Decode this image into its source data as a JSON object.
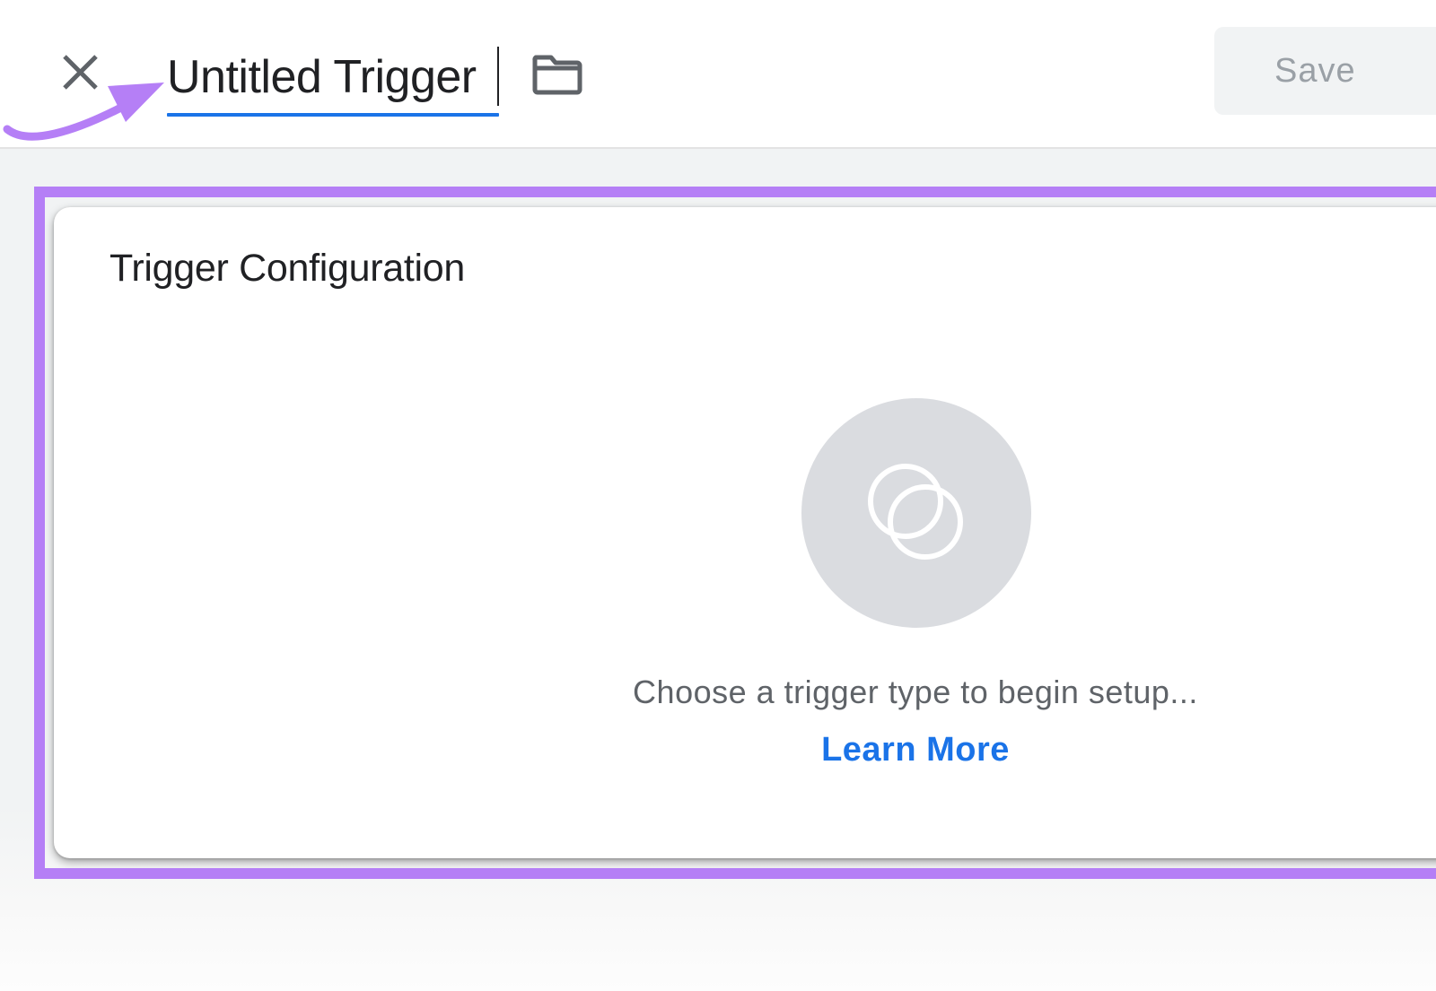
{
  "header": {
    "title_value": "Untitled Trigger",
    "save_label": "Save",
    "close_icon": "close-icon",
    "folder_icon": "folder-icon"
  },
  "card": {
    "title": "Trigger Configuration",
    "trigger_type_icon": "trigger-type-icon",
    "hint": "Choose a trigger type to begin setup...",
    "learn_more_label": "Learn More"
  },
  "colors": {
    "accent_blue": "#1a73e8",
    "annotation_purple": "#b57ff6",
    "placeholder_circle": "#dadce0",
    "page_background": "#f1f3f4"
  }
}
